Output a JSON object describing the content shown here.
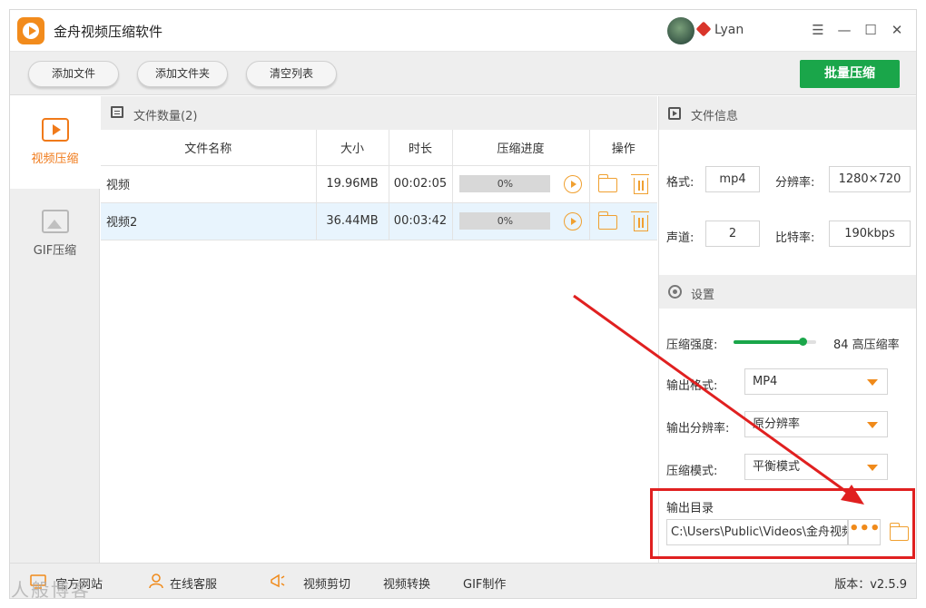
{
  "window": {
    "title": "金舟视频压缩软件"
  },
  "user": {
    "name": "Lyan"
  },
  "window_controls": {
    "menu": "☰",
    "minimize": "—",
    "maximize": "☐",
    "close": "✕"
  },
  "toolbar": {
    "add_file": "添加文件",
    "add_folder": "添加文件夹",
    "clear_list": "清空列表",
    "batch_compress": "批量压缩"
  },
  "sidebar": {
    "items": [
      {
        "label": "视频压缩",
        "active": true
      },
      {
        "label": "GIF压缩",
        "active": false
      }
    ]
  },
  "file_list": {
    "count_label": "文件数量(2)",
    "columns": [
      "文件名称",
      "大小",
      "时长",
      "压缩进度",
      "操作"
    ],
    "rows": [
      {
        "name": "视频",
        "size": "19.96MB",
        "duration": "00:02:05",
        "progress_text": "0%",
        "progress": 0,
        "selected": false
      },
      {
        "name": "视频2",
        "size": "36.44MB",
        "duration": "00:03:42",
        "progress_text": "0%",
        "progress": 0,
        "selected": true
      }
    ]
  },
  "file_info": {
    "title": "文件信息",
    "format_label": "格式:",
    "format": "mp4",
    "resolution_label": "分辨率:",
    "resolution": "1280×720",
    "channel_label": "声道:",
    "channel": "2",
    "bitrate_label": "比特率:",
    "bitrate": "190kbps"
  },
  "settings": {
    "title": "设置",
    "strength_label": "压缩强度:",
    "strength_value": 84,
    "strength_text": "84 高压缩率",
    "output_format_label": "输出格式:",
    "output_format": "MP4",
    "output_resolution_label": "输出分辨率:",
    "output_resolution": "原分辨率",
    "mode_label": "压缩模式:",
    "mode": "平衡模式",
    "output_dir_label": "输出目录",
    "output_dir": "C:\\Users\\Public\\Videos\\金舟视频压缩软件",
    "browse": "•••"
  },
  "footer": {
    "website": "官方网站",
    "support": "在线客服",
    "video_cut": "视频剪切",
    "video_convert": "视频转换",
    "gif_make": "GIF制作",
    "version": "版本：v2.5.9"
  },
  "watermark": "人般博客",
  "colors": {
    "accent_green": "#1aa64a",
    "accent_orange": "#f08a1a",
    "annotation_red": "#e02020"
  }
}
